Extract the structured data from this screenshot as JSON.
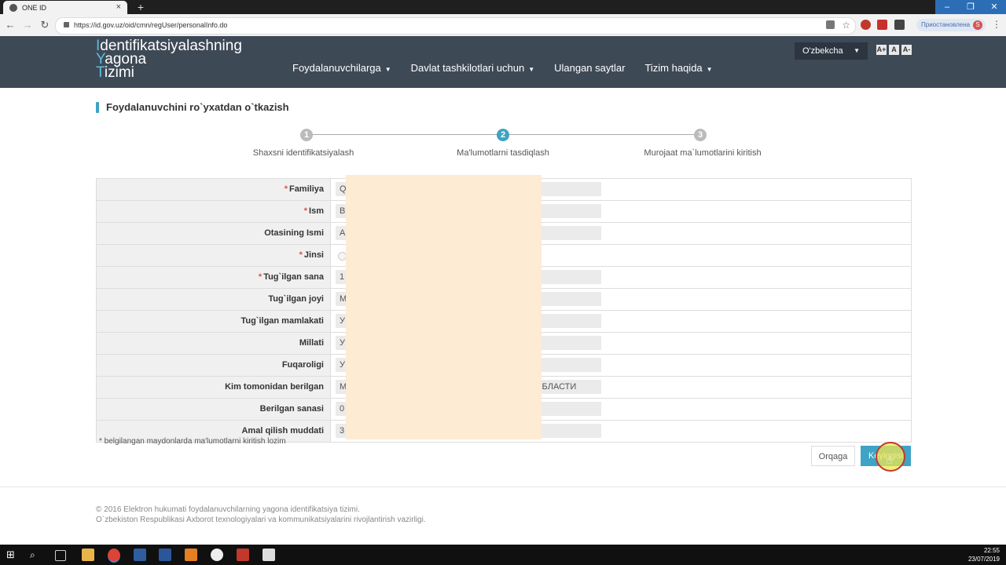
{
  "browser": {
    "tab_title": "ONE ID",
    "url": "https://id.gov.uz/oid/cmn/regUser/personalInfo.do",
    "profile_label": "Приостановлена",
    "profile_initial": "S"
  },
  "header": {
    "logo_lines": [
      {
        "cap": "I",
        "rest": "dentifikatsiyalashning"
      },
      {
        "cap": "Y",
        "rest": "agona"
      },
      {
        "cap": "T",
        "rest": "izimi"
      }
    ],
    "nav": [
      {
        "label": "Foydalanuvchilarga",
        "dropdown": true
      },
      {
        "label": "Davlat tashkilotlari uchun",
        "dropdown": true
      },
      {
        "label": "Ulangan saytlar",
        "dropdown": false
      },
      {
        "label": "Tizim haqida",
        "dropdown": true
      }
    ],
    "language": "O'zbekcha",
    "font_sizes": [
      "A+",
      "A",
      "A-"
    ]
  },
  "page": {
    "title": "Foydalanuvchini ro`yxatdan o`tkazish",
    "steps": [
      {
        "num": "1",
        "label": "Shaxsni identifikatsiyalash",
        "active": false
      },
      {
        "num": "2",
        "label": "Ma'lumotlarni tasdiqlash",
        "active": true
      },
      {
        "num": "3",
        "label": "Murojaat ma`lumotlarini kiritish",
        "active": false
      }
    ],
    "fields": [
      {
        "label": "Familiya",
        "required": true,
        "value": "Q",
        "tail": ""
      },
      {
        "label": "Ism",
        "required": true,
        "value": "B",
        "tail": ""
      },
      {
        "label": "Otasining Ismi",
        "required": false,
        "value": "A",
        "tail": ""
      },
      {
        "label": "Jinsi",
        "required": true,
        "value": "",
        "tail": "",
        "radio": true
      },
      {
        "label": "Tug`ilgan sana",
        "required": true,
        "value": "1",
        "tail": ""
      },
      {
        "label": "Tug`ilgan joyi",
        "required": false,
        "value": "M",
        "tail": ""
      },
      {
        "label": "Tug`ilgan mamlakati",
        "required": false,
        "value": "У",
        "tail": ""
      },
      {
        "label": "Millati",
        "required": false,
        "value": "У",
        "tail": ""
      },
      {
        "label": "Fuqaroligi",
        "required": false,
        "value": "У",
        "tail": ""
      },
      {
        "label": "Kim tomonidan berilgan",
        "required": false,
        "value": "M",
        "tail": "ОБЛАСТИ"
      },
      {
        "label": "Berilgan sanasi",
        "required": false,
        "value": "0",
        "tail": ""
      },
      {
        "label": "Amal qilish muddati",
        "required": false,
        "value": "3",
        "tail": ""
      }
    ],
    "required_note": "* belgilangan maydonlarda ma'lumotlarni kiritish lozim",
    "back_button": "Orqaga",
    "next_button": "Keyingisi"
  },
  "footer": {
    "line1": "© 2016 Elektron hukumati foydalanuvchilarning yagona identifikatsiya tizimi.",
    "line2": "O`zbekiston Respublikasi Axborot texnologiyalari va kommunikatsiyalarini rivojlantirish vazirligi."
  },
  "taskbar": {
    "time": "22:55",
    "date": "23/07/2019"
  }
}
